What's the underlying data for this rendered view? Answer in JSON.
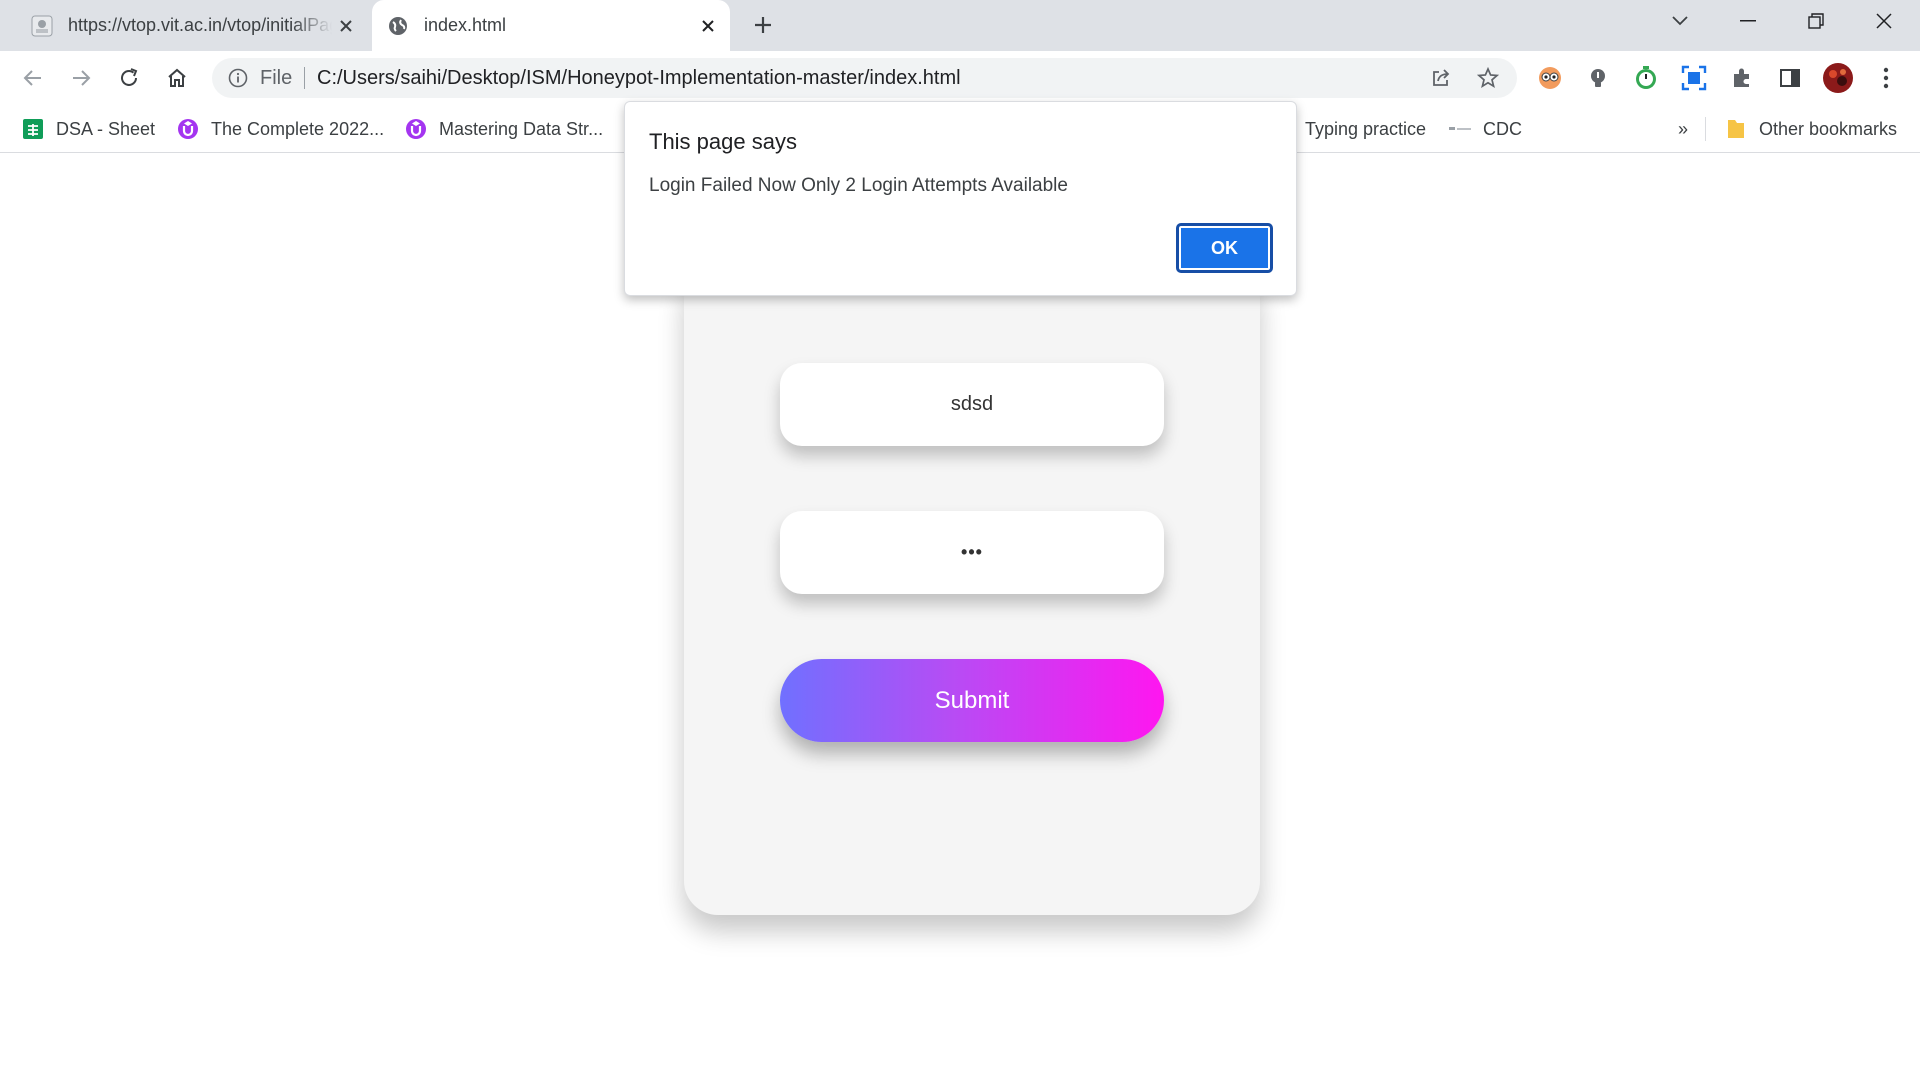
{
  "tabs": [
    {
      "title": "https://vtop.vit.ac.in/vtop/initialPage",
      "active": false,
      "icon": "vtop-favicon"
    },
    {
      "title": "index.html",
      "active": true,
      "icon": "globe-icon"
    }
  ],
  "address_bar": {
    "scheme_label": "File",
    "url": "C:/Users/saihi/Desktop/ISM/Honeypot-Implementation-master/index.html"
  },
  "bookmarks": [
    {
      "label": "DSA - Sheet",
      "icon": "sheets-icon",
      "color": "#0f9d58"
    },
    {
      "label": "The Complete 2022...",
      "icon": "udemy-icon",
      "color": "#a435f0"
    },
    {
      "label": "Mastering Data Str...",
      "icon": "udemy-icon",
      "color": "#a435f0"
    },
    {
      "label": "Typing practice",
      "icon": "",
      "color": ""
    },
    {
      "label": "CDC",
      "icon": "cdc-icon",
      "color": ""
    },
    {
      "label": "»",
      "icon": "",
      "color": ""
    },
    {
      "label": "Other bookmarks",
      "icon": "folder-icon",
      "color": "#f6c445"
    }
  ],
  "dialog": {
    "title": "This page says",
    "message": "Login Failed Now Only 2 Login Attempts Available",
    "ok_label": "OK"
  },
  "form": {
    "username_value": "sdsd",
    "password_value": "•••",
    "submit_label": "Submit"
  },
  "colors": {
    "accent": "#1a73e8",
    "submit_gradient_start": "#7070ff",
    "submit_gradient_end": "#ff16f0"
  }
}
